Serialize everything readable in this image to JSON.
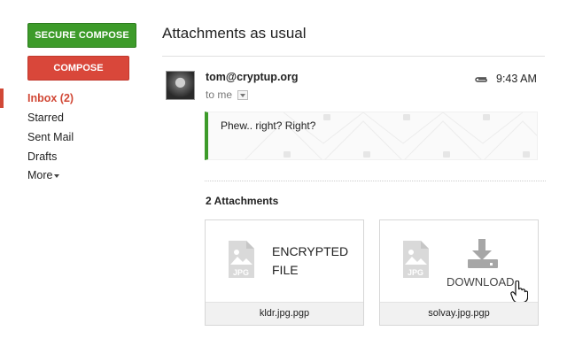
{
  "sidebar": {
    "secure_compose": "SECURE COMPOSE",
    "compose": "COMPOSE",
    "items": [
      {
        "label": "Inbox (2)"
      },
      {
        "label": "Starred"
      },
      {
        "label": "Sent Mail"
      },
      {
        "label": "Drafts"
      },
      {
        "label": "More"
      }
    ]
  },
  "email": {
    "subject": "Attachments as usual",
    "sender": "tom@cryptup.org",
    "to": "to me",
    "time": "9:43 AM",
    "body": "Phew.. right? Right?"
  },
  "attachments": {
    "count_label": "2 Attachments",
    "items": [
      {
        "name": "kldr.jpg.pgp",
        "line1": "ENCRYPTED",
        "line2": "FILE",
        "type_icon": "JPG"
      },
      {
        "name": "solvay.jpg.pgp",
        "action": "DOWNLOAD",
        "type_icon": "JPG"
      }
    ]
  },
  "colors": {
    "secure_green": "#3d9b2a",
    "compose_red": "#d9473a",
    "inbox_red": "#d14836"
  }
}
